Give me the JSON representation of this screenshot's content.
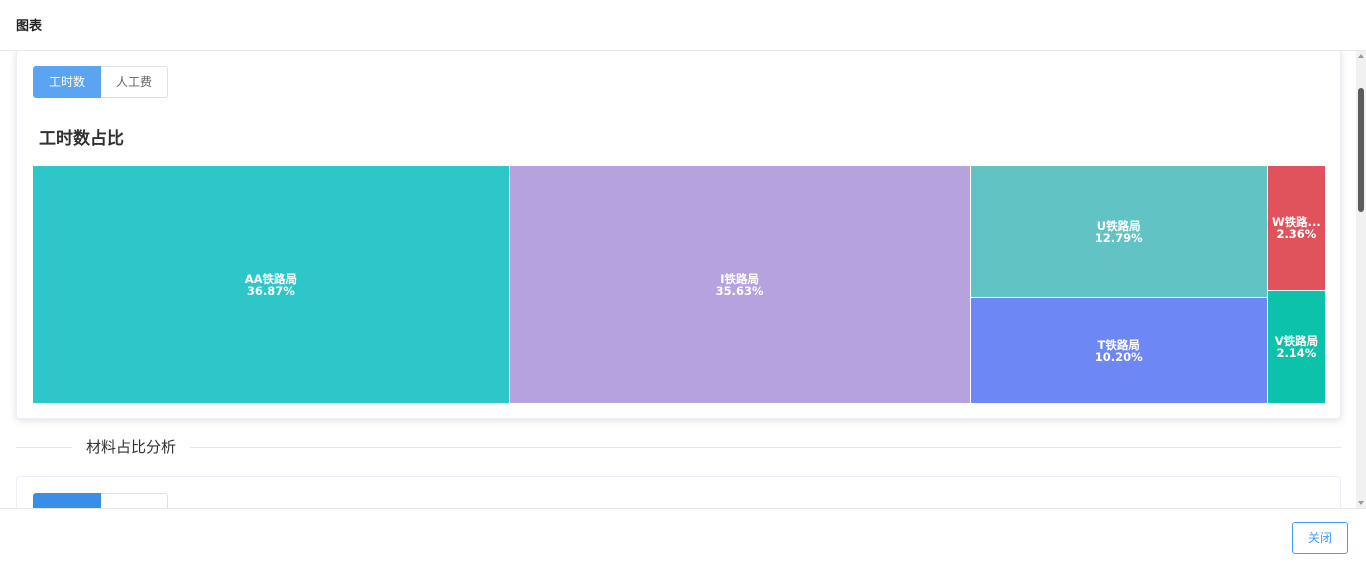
{
  "dialog": {
    "title": "图表",
    "close_label": "关闭"
  },
  "section1": {
    "tabs": [
      {
        "label": "工时数",
        "active": true
      },
      {
        "label": "人工费",
        "active": false
      }
    ],
    "chart_title": "工时数占比"
  },
  "chart_data": {
    "type": "treemap",
    "title": "工时数占比",
    "nodes": [
      {
        "name": "AA铁路局",
        "label": "AA铁路局",
        "percent": 36.87,
        "percent_label": "36.87%",
        "color": "#2ec7c9"
      },
      {
        "name": "I铁路局",
        "label": "I铁路局",
        "percent": 35.63,
        "percent_label": "35.63%",
        "color": "#b6a2de"
      },
      {
        "name": "U铁路局",
        "label": "U铁路局",
        "percent": 12.79,
        "percent_label": "12.79%",
        "color": "#62c3c5"
      },
      {
        "name": "T铁路局",
        "label": "T铁路局",
        "percent": 10.2,
        "percent_label": "10.20%",
        "color": "#6d87f4"
      },
      {
        "name": "W铁路局",
        "label": "W铁路...",
        "percent": 2.36,
        "percent_label": "2.36%",
        "color": "#e0535c"
      },
      {
        "name": "V铁路局",
        "label": "V铁路局",
        "percent": 2.14,
        "percent_label": "2.14%",
        "color": "#0cc2aa"
      }
    ]
  },
  "section2": {
    "divider_label": "材料占比分析",
    "tabs": [
      {
        "label": "",
        "active": true
      },
      {
        "label": "",
        "active": false
      }
    ]
  },
  "colors": {
    "primary": "#409eff",
    "active_tab": "#5aa4f2"
  }
}
